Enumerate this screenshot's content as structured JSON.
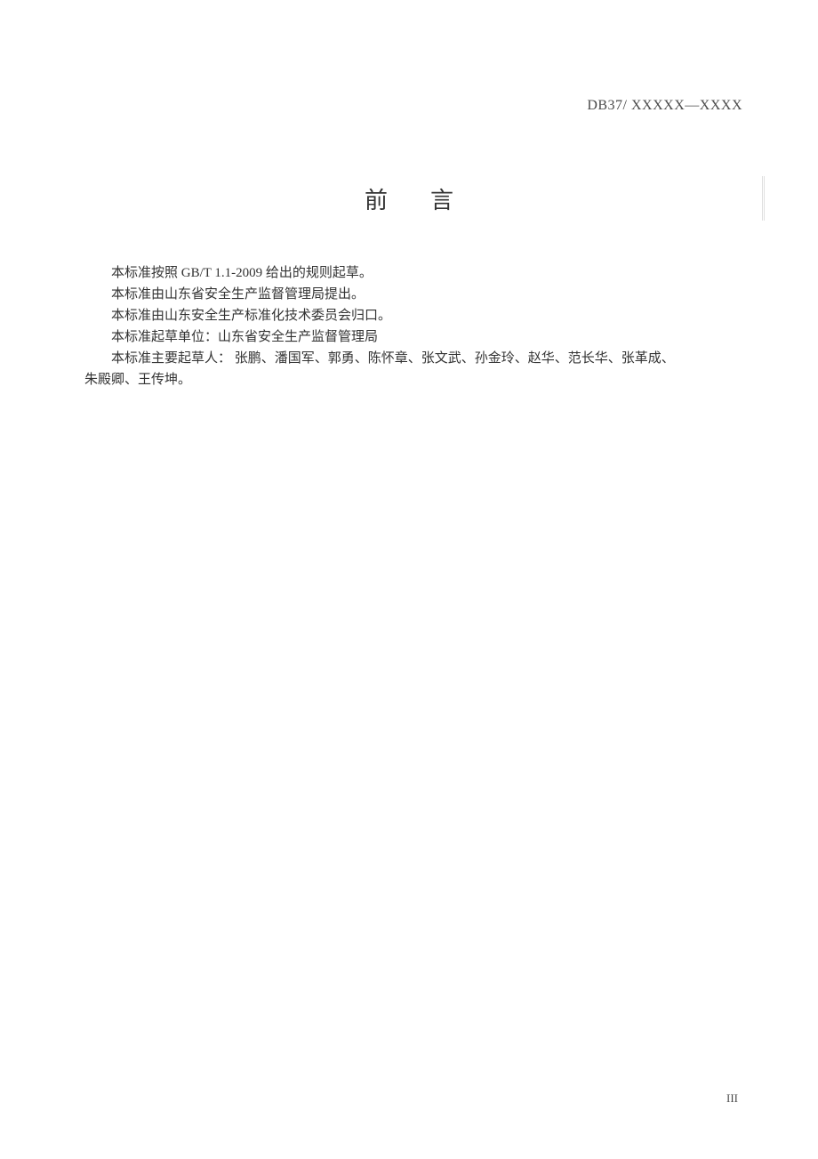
{
  "header": {
    "code": "DB37/ XXXXX—XXXX"
  },
  "title": "前言",
  "paragraphs": {
    "p1": "本标准按照  GB/T 1.1-2009   给出的规则起草。",
    "p2": "本标准由山东省安全生产监督管理局提出。",
    "p3": "本标准由山东安全生产标准化技术委员会归口。",
    "p4": "本标准起草单位：山东省安全生产监督管理局",
    "p5": "本标准主要起草人：     张鹏、潘国军、郭勇、陈怀章、张文武、孙金玲、赵华、范长华、张革成、",
    "p6": "朱殿卿、王传坤。"
  },
  "footer": {
    "pageNumber": "III"
  }
}
